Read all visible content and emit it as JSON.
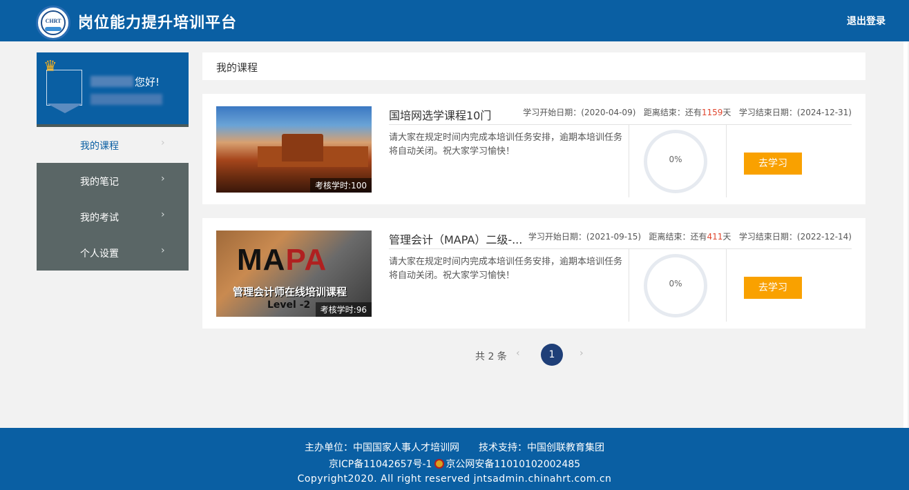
{
  "header": {
    "title": "岗位能力提升培训平台",
    "logout_label": "退出登录",
    "logo_text": "CHRT"
  },
  "sidebar": {
    "greeting": "您好!",
    "items": [
      {
        "label": "我的课程"
      },
      {
        "label": "我的笔记"
      },
      {
        "label": "我的考试"
      },
      {
        "label": "个人设置"
      }
    ]
  },
  "main": {
    "section_title": "我的课程",
    "courses": [
      {
        "title": "国培网选学课程10门",
        "start_label": "学习开始日期：",
        "start_date": "(2020-04-09)",
        "remain_label": "距离结束：还有",
        "remain_days": "1159",
        "remain_unit": "天",
        "end_label": "学习结束日期：",
        "end_date": "(2024-12-31)",
        "description": "请大家在规定时间内完成本培训任务安排，逾期本培训任务将自动关闭。祝大家学习愉快！",
        "hours": "考核学时:100",
        "progress": "0%",
        "button": "去学习"
      },
      {
        "title": "管理会计（MAPA）二级-...",
        "start_label": "学习开始日期：",
        "start_date": "(2021-09-15)",
        "remain_label": "距离结束：还有",
        "remain_days": "411",
        "remain_unit": "天",
        "end_label": "学习结束日期：",
        "end_date": "(2022-12-14)",
        "description": "请大家在规定时间内完成本培训任务安排，逾期本培训任务将自动关闭。祝大家学习愉快！",
        "hours": "考核学时:96",
        "progress": "0%",
        "button": "去学习",
        "thumb_title_1": "MA",
        "thumb_title_2": "PA",
        "thumb_subtitle": "管理会计师在线培训课程",
        "thumb_level": "Level -2"
      }
    ]
  },
  "pagination": {
    "total": "共 2 条",
    "current": "1",
    "prev": "‹",
    "next": "›"
  },
  "footer": {
    "line1": "主办单位：中国国家人事人才培训网　　技术支持：中国创联教育集团",
    "icp": "京ICP备11042657号-1",
    "police": "京公网安备11010102002485",
    "copyright": "Copyright2020. All right reserved jntsadmin.chinahrt.com.cn"
  },
  "colors": {
    "brand": "#0a5fa3",
    "button": "#f9a100",
    "highlight": "#e0452d",
    "sidebar_menu": "#5a6666"
  }
}
